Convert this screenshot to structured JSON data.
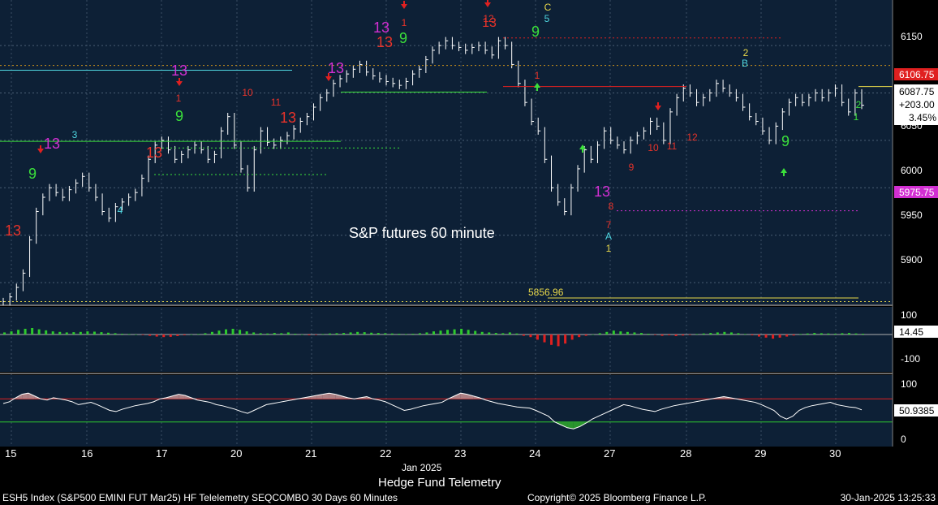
{
  "chart_data": [
    {
      "type": "candlestick",
      "title": "S&P futures 60 minute",
      "y_ticks": [
        5900,
        5950,
        6000,
        6050,
        6150
      ],
      "ylim": [
        5877,
        6198
      ],
      "x_tick_labels": [
        "15",
        "16",
        "17",
        "20",
        "21",
        "22",
        "23",
        "24",
        "27",
        "28",
        "29",
        "30"
      ],
      "x_month_label": "Jan 2025",
      "x_subtitle": "Hedge Fund Telemetry",
      "last_price_label": "6106.75",
      "last_price_value": 6106.75,
      "low_marker_label": "5975.75",
      "low_marker_value": 5975.75,
      "quote_box": {
        "price": "6087.75",
        "change": "+203.00",
        "pct": "3.45%"
      },
      "reference_level_label": "5856.96",
      "reference_level_value": 5856.96,
      "close_path": [
        [
          0,
          5880
        ],
        [
          2,
          5885
        ],
        [
          4,
          5895
        ],
        [
          6,
          5910
        ],
        [
          8,
          5945
        ],
        [
          10,
          5975
        ],
        [
          12,
          5990
        ],
        [
          14,
          6000
        ],
        [
          15,
          5995
        ],
        [
          16,
          5990
        ],
        [
          17,
          5998
        ],
        [
          18,
          6005
        ],
        [
          19,
          6012
        ],
        [
          20,
          6000
        ],
        [
          21,
          5990
        ],
        [
          22,
          5975
        ],
        [
          23,
          5968
        ],
        [
          24,
          5980
        ],
        [
          25,
          5985
        ],
        [
          26,
          5990
        ],
        [
          27,
          5995
        ],
        [
          28,
          6010
        ],
        [
          29,
          6030
        ],
        [
          30,
          6045
        ],
        [
          31,
          6050
        ],
        [
          32,
          6040
        ],
        [
          33,
          6030
        ],
        [
          34,
          6035
        ],
        [
          35,
          6040
        ],
        [
          36,
          6045
        ],
        [
          37,
          6040
        ],
        [
          38,
          6030
        ],
        [
          39,
          6035
        ],
        [
          40,
          6060
        ],
        [
          41,
          6075
        ],
        [
          42,
          6045
        ],
        [
          43,
          6020
        ],
        [
          44,
          6000
        ],
        [
          45,
          6040
        ],
        [
          46,
          6060
        ],
        [
          47,
          6048
        ],
        [
          48,
          6045
        ],
        [
          49,
          6050
        ],
        [
          50,
          6055
        ],
        [
          51,
          6062
        ],
        [
          52,
          6070
        ],
        [
          53,
          6075
        ],
        [
          54,
          6085
        ],
        [
          55,
          6095
        ],
        [
          56,
          6100
        ],
        [
          57,
          6110
        ],
        [
          58,
          6115
        ],
        [
          59,
          6120
        ],
        [
          60,
          6125
        ],
        [
          61,
          6130
        ],
        [
          62,
          6122
        ],
        [
          63,
          6118
        ],
        [
          64,
          6115
        ],
        [
          65,
          6112
        ],
        [
          66,
          6110
        ],
        [
          67,
          6108
        ],
        [
          68,
          6112
        ],
        [
          69,
          6120
        ],
        [
          70,
          6125
        ],
        [
          71,
          6135
        ],
        [
          72,
          6145
        ],
        [
          73,
          6150
        ],
        [
          74,
          6155
        ],
        [
          75,
          6150
        ],
        [
          76,
          6148
        ],
        [
          77,
          6145
        ],
        [
          78,
          6148
        ],
        [
          79,
          6150
        ],
        [
          80,
          6145
        ],
        [
          81,
          6140
        ],
        [
          82,
          6155
        ],
        [
          83,
          6150
        ],
        [
          84,
          6130
        ],
        [
          85,
          6110
        ],
        [
          86,
          6090
        ],
        [
          87,
          6070
        ],
        [
          88,
          6060
        ],
        [
          89,
          6030
        ],
        [
          90,
          6000
        ],
        [
          91,
          5985
        ],
        [
          92,
          5975
        ],
        [
          93,
          6000
        ],
        [
          94,
          6020
        ],
        [
          95,
          6040
        ],
        [
          96,
          6030
        ],
        [
          97,
          6045
        ],
        [
          98,
          6060
        ],
        [
          99,
          6050
        ],
        [
          100,
          6045
        ],
        [
          101,
          6040
        ],
        [
          102,
          6050
        ],
        [
          103,
          6055
        ],
        [
          104,
          6060
        ],
        [
          105,
          6070
        ],
        [
          106,
          6065
        ],
        [
          107,
          6050
        ],
        [
          108,
          6080
        ],
        [
          109,
          6095
        ],
        [
          110,
          6105
        ],
        [
          111,
          6100
        ],
        [
          112,
          6090
        ],
        [
          113,
          6095
        ],
        [
          114,
          6100
        ],
        [
          115,
          6110
        ],
        [
          116,
          6105
        ],
        [
          117,
          6100
        ],
        [
          118,
          6095
        ],
        [
          119,
          6085
        ],
        [
          120,
          6075
        ],
        [
          121,
          6070
        ],
        [
          122,
          6060
        ],
        [
          123,
          6050
        ],
        [
          124,
          6065
        ],
        [
          125,
          6080
        ],
        [
          126,
          6090
        ],
        [
          127,
          6095
        ],
        [
          128,
          6090
        ],
        [
          129,
          6095
        ],
        [
          130,
          6100
        ],
        [
          131,
          6095
        ],
        [
          132,
          6100
        ],
        [
          133,
          6105
        ],
        [
          134,
          6090
        ],
        [
          135,
          6080
        ],
        [
          136,
          6100
        ],
        [
          137,
          6087
        ]
      ],
      "annotations": [
        {
          "text": "13",
          "color": "#e8332a"
        },
        {
          "text": "13",
          "color": "#d22fd2"
        },
        {
          "text": "13",
          "color": "#e8332a"
        },
        {
          "text": "13",
          "color": "#d22fd2"
        },
        {
          "text": "13",
          "color": "#e8332a"
        },
        {
          "text": "13",
          "color": "#d22fd2"
        },
        {
          "text": "13",
          "color": "#d22fd2"
        },
        {
          "text": "13",
          "color": "#e8332a"
        },
        {
          "text": "13",
          "color": "#e8332a"
        },
        {
          "text": "13",
          "color": "#d22fd2"
        },
        {
          "text": "9",
          "color": "#3be03b"
        },
        {
          "text": "9",
          "color": "#3be03b"
        },
        {
          "text": "9",
          "color": "#3be03b"
        },
        {
          "text": "9",
          "color": "#3be03b"
        },
        {
          "text": "9",
          "color": "#3be03b"
        },
        {
          "text": "1",
          "color": "#e8332a"
        },
        {
          "text": "1",
          "color": "#e8332a"
        },
        {
          "text": "1",
          "color": "#e8332a"
        },
        {
          "text": "1",
          "color": "#e8d84a"
        },
        {
          "text": "1",
          "color": "#3be03b"
        },
        {
          "text": "2",
          "color": "#e8d84a"
        },
        {
          "text": "2",
          "color": "#3be03b"
        },
        {
          "text": "3",
          "color": "#4fd6e0"
        },
        {
          "text": "4",
          "color": "#4fd6e0"
        },
        {
          "text": "5",
          "color": "#4fd6e0"
        },
        {
          "text": "7",
          "color": "#e8332a"
        },
        {
          "text": "8",
          "color": "#e8332a"
        },
        {
          "text": "9",
          "color": "#e8332a"
        },
        {
          "text": "10",
          "color": "#e8332a"
        },
        {
          "text": "11",
          "color": "#e8332a"
        },
        {
          "text": "12",
          "color": "#e8332a"
        },
        {
          "text": "10",
          "color": "#e8332a"
        },
        {
          "text": "11",
          "color": "#e8332a"
        },
        {
          "text": "12",
          "color": "#e8332a"
        },
        {
          "text": "A",
          "color": "#4fd6e0"
        },
        {
          "text": "B",
          "color": "#4fd6e0"
        },
        {
          "text": "C",
          "color": "#e8d84a"
        }
      ]
    },
    {
      "type": "histogram",
      "yticks": [
        "100",
        "-100"
      ],
      "current_value_label": "14.45",
      "values": [
        8,
        12,
        18,
        22,
        25,
        20,
        16,
        12,
        10,
        8,
        9,
        10,
        12,
        11,
        9,
        7,
        5,
        3,
        2,
        0,
        -2,
        -5,
        -8,
        -10,
        -9,
        -6,
        -3,
        0,
        2,
        5,
        10,
        15,
        20,
        22,
        18,
        12,
        8,
        5,
        4,
        6,
        5,
        8,
        3,
        0,
        -3,
        -2,
        2,
        4,
        5,
        6,
        8,
        10,
        9,
        7,
        6,
        5,
        4,
        3,
        2,
        3,
        5,
        8,
        12,
        15,
        18,
        20,
        22,
        18,
        14,
        10,
        8,
        6,
        5,
        8,
        4,
        -5,
        -10,
        -20,
        -30,
        -40,
        -45,
        -35,
        -20,
        -10,
        -5,
        0,
        5,
        10,
        15,
        12,
        10,
        8,
        6,
        3,
        -2,
        -5,
        -3,
        -6,
        -4,
        -2,
        2,
        4,
        6,
        8,
        10,
        8,
        5,
        2,
        -3,
        -8,
        -12,
        -16,
        -12,
        -8,
        -4,
        2,
        4,
        6,
        5,
        4,
        3,
        5,
        6,
        4,
        3
      ],
      "colors": {
        "positive": "#2ec92e",
        "negative": "#e02020"
      }
    },
    {
      "type": "line",
      "yticks": [
        "100",
        "0"
      ],
      "current_value_label": "50.9385",
      "upper_band": 70,
      "lower_band": 30,
      "values": [
        62,
        65,
        72,
        78,
        80,
        75,
        70,
        68,
        72,
        70,
        68,
        65,
        60,
        62,
        64,
        60,
        55,
        50,
        48,
        52,
        55,
        58,
        60,
        62,
        65,
        70,
        72,
        75,
        78,
        76,
        72,
        68,
        66,
        64,
        60,
        58,
        55,
        52,
        48,
        45,
        50,
        55,
        60,
        62,
        64,
        66,
        68,
        70,
        72,
        74,
        76,
        78,
        80,
        78,
        75,
        72,
        70,
        72,
        74,
        70,
        68,
        65,
        60,
        55,
        50,
        52,
        55,
        58,
        60,
        62,
        64,
        70,
        75,
        80,
        78,
        75,
        72,
        68,
        65,
        62,
        60,
        58,
        56,
        55,
        54,
        50,
        45,
        40,
        30,
        25,
        20,
        18,
        22,
        28,
        35,
        40,
        45,
        50,
        55,
        60,
        58,
        55,
        52,
        50,
        48,
        52,
        55,
        58,
        60,
        62,
        64,
        66,
        68,
        70,
        72,
        74,
        72,
        70,
        68,
        66,
        64,
        60,
        55,
        50,
        40,
        35,
        40,
        50,
        55,
        58,
        60,
        62,
        64,
        60,
        58,
        56,
        55,
        51
      ],
      "colors": {
        "above": "#c99090",
        "below": "#2ea22e"
      }
    }
  ],
  "footer": {
    "left": "ESH5 Index (S&P500 EMINI FUT  Mar25) HF Telelemetry SEQCOMBO 30 Days 60 Minutes",
    "center": "Copyright© 2025 Bloomberg Finance L.P.",
    "right": "30-Jan-2025 13:25:33"
  }
}
